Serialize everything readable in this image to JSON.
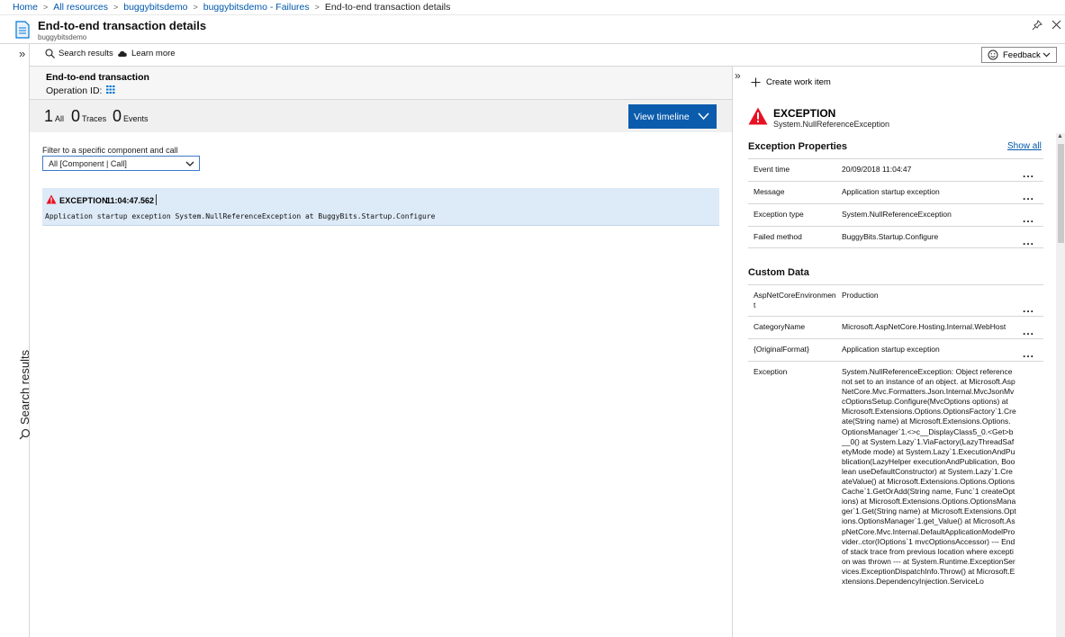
{
  "breadcrumb": {
    "items": [
      "Home",
      "All resources",
      "buggybitsdemo",
      "buggybitsdemo - Failures"
    ],
    "current": "End-to-end transaction details"
  },
  "header": {
    "title": "End-to-end transaction details",
    "subtitle": "buggybitsdemo"
  },
  "rail": {
    "label": "Search results"
  },
  "toolbar": {
    "search_results": "Search results",
    "learn_more": "Learn more",
    "feedback": "Feedback"
  },
  "transaction": {
    "title": "End-to-end transaction",
    "operation_label": "Operation ID:"
  },
  "counts": [
    {
      "num": "1",
      "label": "All"
    },
    {
      "num": "0",
      "label": "Traces"
    },
    {
      "num": "0",
      "label": "Events"
    }
  ],
  "view_timeline": "View timeline",
  "filter": {
    "label": "Filter to a specific component and call",
    "value": "All [Component | Call]"
  },
  "exception_row": {
    "title": "EXCEPTION",
    "time": "11:04:47.562",
    "message": "Application startup exception System.NullReferenceException at BuggyBits.Startup.Configure"
  },
  "details": {
    "create_work_item": "Create work item",
    "exception_title": "EXCEPTION",
    "exception_type": "System.NullReferenceException",
    "properties_title": "Exception Properties",
    "show_all": "Show all",
    "properties": [
      {
        "key": "Event time",
        "value": "20/09/2018 11:04:47"
      },
      {
        "key": "Message",
        "value": "Application startup exception"
      },
      {
        "key": "Exception type",
        "value": "System.NullReferenceException"
      },
      {
        "key": "Failed method",
        "value": "BuggyBits.Startup.Configure"
      }
    ],
    "custom_title": "Custom Data",
    "custom": [
      {
        "key": "AspNetCoreEnvironment",
        "value": "Production"
      },
      {
        "key": "CategoryName",
        "value": "Microsoft.AspNetCore.Hosting.Internal.WebHost"
      },
      {
        "key": "{OriginalFormat}",
        "value": "Application startup exception"
      },
      {
        "key": "Exception",
        "value": "System.NullReferenceException: Object reference not set to an instance of an object. at Microsoft.AspNetCore.Mvc.Formatters.Json.Internal.MvcJsonMvcOptionsSetup.Configure(MvcOptions options) at Microsoft.Extensions.Options.OptionsFactory`1.Create(String name) at Microsoft.Extensions.Options.OptionsManager`1.<>c__DisplayClass5_0.<Get>b__0() at System.Lazy`1.ViaFactory(LazyThreadSafetyMode mode) at System.Lazy`1.ExecutionAndPublication(LazyHelper executionAndPublication, Boolean useDefaultConstructor) at System.Lazy`1.CreateValue() at Microsoft.Extensions.Options.OptionsCache`1.GetOrAdd(String name, Func`1 createOptions) at Microsoft.Extensions.Options.OptionsManager`1.Get(String name) at Microsoft.Extensions.Options.OptionsManager`1.get_Value() at Microsoft.AspNetCore.Mvc.Internal.DefaultApplicationModelProvider..ctor(IOptions`1 mvcOptionsAccessor) --- End of stack trace from previous location where exception was thrown --- at System.Runtime.ExceptionServices.ExceptionDispatchInfo.Throw() at Microsoft.Extensions.DependencyInjection.ServiceLo"
      }
    ]
  },
  "colors": {
    "accent": "#0b5cad",
    "link": "#0058ad",
    "error": "#e81123",
    "selected_row": "#ddeaf7"
  }
}
